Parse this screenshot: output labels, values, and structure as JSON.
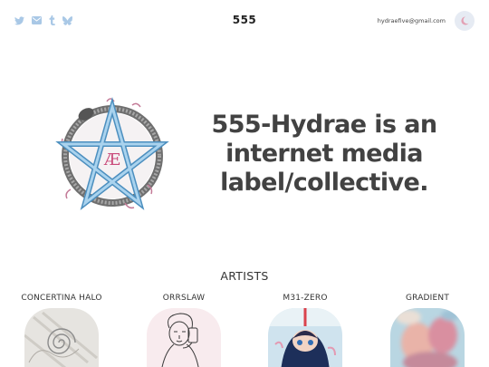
{
  "header": {
    "brand": "555",
    "email": "hydraefive@gmail.com",
    "social_icons": [
      "twitter-icon",
      "mail-icon",
      "tumblr-icon",
      "bluesky-icon"
    ],
    "theme_icon": "moon-icon",
    "icon_color": "#a9c8e6",
    "moon_color": "#e3a1b4"
  },
  "hero": {
    "logo_icon": "pentagram-ouroboros-logo",
    "logo_letters": "Æ",
    "tagline": "555-Hydrae is an internet media label/collective."
  },
  "artists": {
    "heading": "ARTISTS",
    "items": [
      {
        "name": "CONCERTINA HALO",
        "thumb_icon": "spiral-doodle-thumbnail"
      },
      {
        "name": "ORRSLAW",
        "thumb_icon": "line-drawing-figure-thumbnail"
      },
      {
        "name": "M31-ZERO",
        "thumb_icon": "anime-character-thumbnail"
      },
      {
        "name": "GRADIENT",
        "thumb_icon": "blurry-photo-thumbnail"
      }
    ]
  }
}
